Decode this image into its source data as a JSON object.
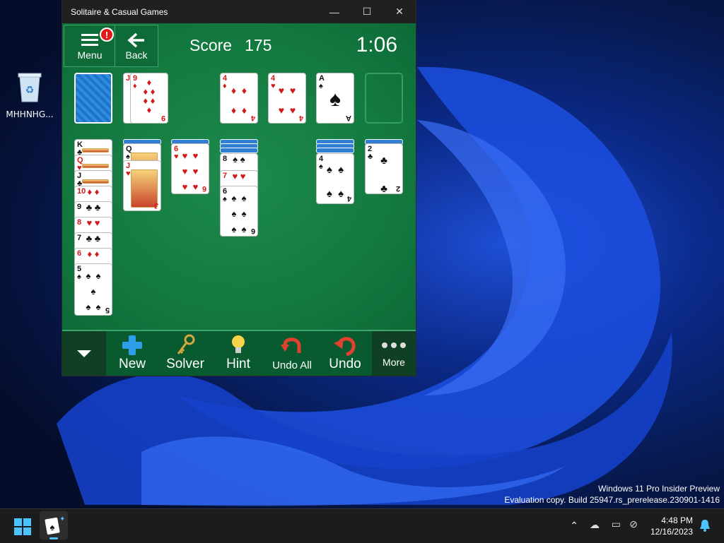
{
  "desktop": {
    "recycle_bin_label": "MHHNHG...",
    "watermark_line1": "Windows 11 Pro Insider Preview",
    "watermark_line2": "Evaluation copy. Build 25947.rs_prerelease.230901-1416"
  },
  "window": {
    "title": "Solitaire & Casual Games",
    "controls": [
      "minimize-icon",
      "maximize-icon",
      "close-icon"
    ]
  },
  "header": {
    "menu_label": "Menu",
    "menu_badge": "!",
    "back_label": "Back",
    "score_label": "Score",
    "score_value": "175",
    "timer": "1:06"
  },
  "waste": [
    {
      "rank": "J",
      "suit": "♦",
      "color": "red"
    },
    {
      "rank": "9",
      "suit": "♦",
      "color": "red"
    }
  ],
  "foundations": [
    {
      "rank": "4",
      "suit": "♦",
      "color": "red"
    },
    {
      "rank": "4",
      "suit": "♥",
      "color": "red"
    },
    {
      "rank": "A",
      "suit": "♠",
      "color": "blk"
    }
  ],
  "tableau": {
    "col1": [
      "K♣",
      "Q♥",
      "J♣",
      "10♦",
      "9♣",
      "8♥",
      "7♣",
      "6♦",
      "5♠"
    ],
    "col2": [
      "Q♠",
      "J♥"
    ],
    "col3": [
      "6♥"
    ],
    "col4": [
      "8♠",
      "7♥",
      "6♠"
    ],
    "col6": [
      "4♠"
    ],
    "col7": [
      "2♣"
    ]
  },
  "toolbar": {
    "new_label": "New",
    "solver_label": "Solver",
    "hint_label": "Hint",
    "undo_all_label": "Undo All",
    "undo_label": "Undo",
    "more_label": "More"
  },
  "taskbar": {
    "time": "4:48 PM",
    "date": "12/16/2023"
  },
  "colors": {
    "felt": "#137a40",
    "toolbar": "#0a5a30",
    "accent_red": "#d21818"
  }
}
